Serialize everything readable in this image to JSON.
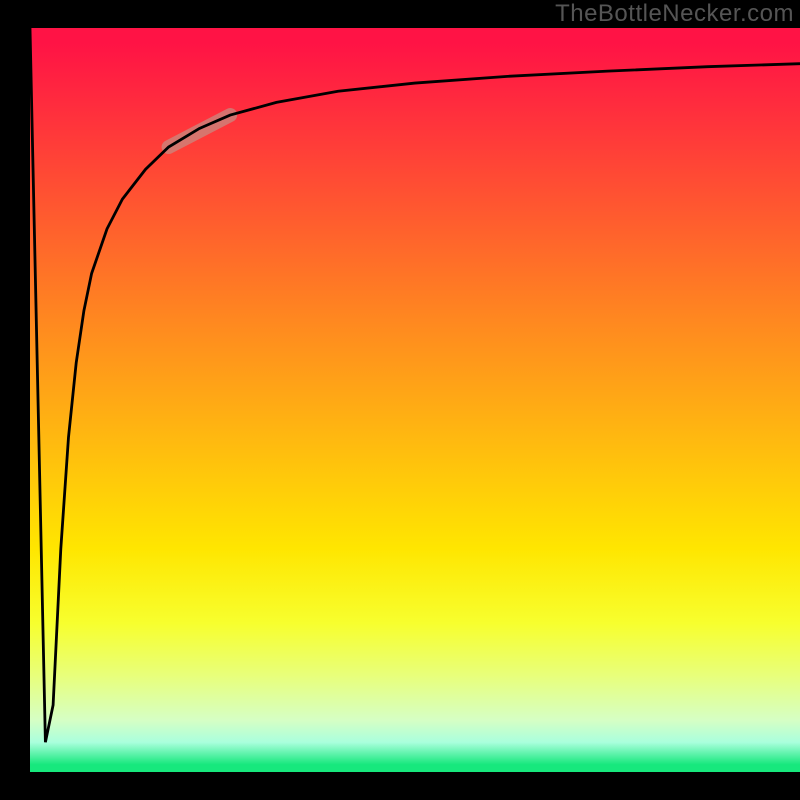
{
  "watermark": "TheBottleNecker.com",
  "colors": {
    "frame": "#000000",
    "gradient_top": "#ff1345",
    "gradient_mid": "#ffe600",
    "gradient_bottom": "#17e87d",
    "curve": "#000000",
    "marker": "#c78d83"
  },
  "chart_data": {
    "type": "line",
    "title": "",
    "xlabel": "",
    "ylabel": "",
    "xlim": [
      0,
      100
    ],
    "ylim": [
      0,
      100
    ],
    "x": [
      0,
      2,
      3,
      4,
      5,
      6,
      7,
      8,
      10,
      12,
      15,
      18,
      22,
      26,
      32,
      40,
      50,
      62,
      75,
      88,
      100
    ],
    "values": [
      100,
      4,
      9,
      30,
      45,
      55,
      62,
      67,
      73,
      77,
      81,
      84,
      86.5,
      88.3,
      90,
      91.5,
      92.6,
      93.5,
      94.2,
      94.8,
      95.2
    ],
    "marker_segment": {
      "x0": 18,
      "y0": 84,
      "x1": 26,
      "y1": 88.3
    },
    "notes": "Values are approximate readings from the figure; y is plotted from bottom, x from left. The background is a vertical gradient red→yellow→green with a thin green band near the bottom. A black frame surrounds the plot; no axis ticks or labels are shown."
  }
}
